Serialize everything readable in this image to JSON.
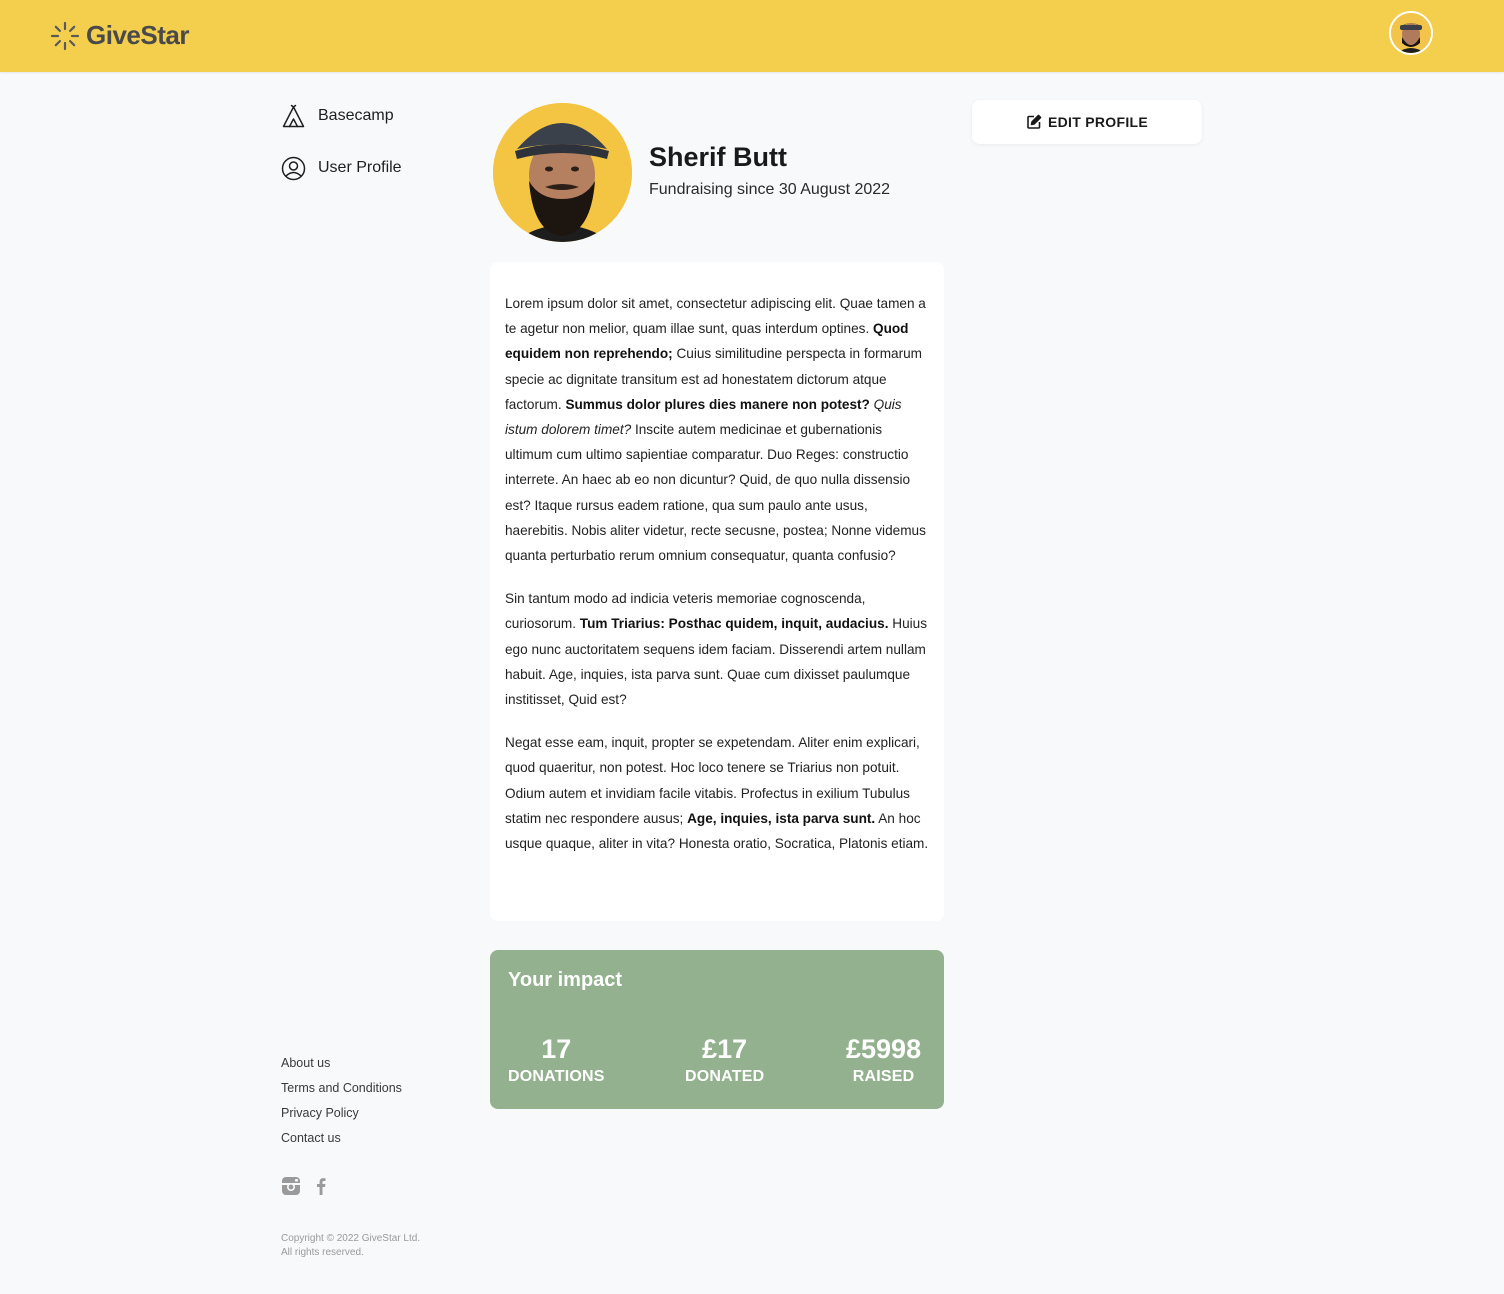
{
  "app": {
    "logo_text": "GiveStar",
    "logo_icon": "sunburst-icon",
    "accent_color": "#f4cf4d",
    "impact_color": "#93b18e"
  },
  "header": {
    "avatar_icon": "user-avatar"
  },
  "sidebar": {
    "items": [
      {
        "label": "Basecamp",
        "icon": "tent-icon"
      },
      {
        "label": "User Profile",
        "icon": "user-circle-icon"
      }
    ]
  },
  "profile": {
    "name": "Sherif Butt",
    "since": "Fundraising since 30 August 2022",
    "edit_label": "EDIT PROFILE"
  },
  "bio": {
    "p1": {
      "t1": "Lorem ipsum dolor sit amet, consectetur adipiscing elit. Quae tamen a te agetur non melior, quam illae sunt, quas interdum optines. ",
      "b1": "Quod equidem non reprehendo;",
      "t2": " Cuius similitudine perspecta in formarum specie ac dignitate transitum est ad honestatem dictorum atque factorum. ",
      "b2": "Summus dolor plures dies manere non potest?",
      "i1": "Quis istum dolorem timet?",
      "t3": " Inscite autem medicinae et gubernationis ultimum cum ultimo sapientiae comparatur. Duo Reges: constructio interrete. An haec ab eo non dicuntur? Quid, de quo nulla dissensio est? Itaque rursus eadem ratione, qua sum paulo ante usus, haerebitis. Nobis aliter videtur, recte secusne, postea; Nonne videmus quanta perturbatio rerum omnium consequatur, quanta confusio?"
    },
    "p2": {
      "t1": "Sin tantum modo ad indicia veteris memoriae cognoscenda, curiosorum. ",
      "b1": "Tum Triarius: Posthac quidem, inquit, audacius.",
      "t2": " Huius ego nunc auctoritatem sequens idem faciam. Disserendi artem nullam habuit. Age, inquies, ista parva sunt. Quae cum dixisset paulumque institisset, Quid est?"
    },
    "p3": {
      "t1": "Negat esse eam, inquit, propter se expetendam. Aliter enim explicari, quod quaeritur, non potest. Hoc loco tenere se Triarius non potuit. Odium autem et invidiam facile vitabis. Profectus in exilium Tubulus statim nec respondere ausus; ",
      "b1": "Age, inquies, ista parva sunt.",
      "t2": " An hoc usque quaque, aliter in vita? Honesta oratio, Socratica, Platonis etiam."
    }
  },
  "impact": {
    "title": "Your impact",
    "stats": [
      {
        "value": "17",
        "label": "DONATIONS"
      },
      {
        "value": "£17",
        "label": "DONATED"
      },
      {
        "value": "£5998",
        "label": "RAISED"
      }
    ]
  },
  "footer": {
    "links": [
      "About us",
      "Terms and Conditions",
      "Privacy Policy",
      "Contact us"
    ],
    "social": [
      "instagram-icon",
      "facebook-icon"
    ],
    "copyright": "Copyright © 2022 GiveStar Ltd. All rights reserved."
  }
}
